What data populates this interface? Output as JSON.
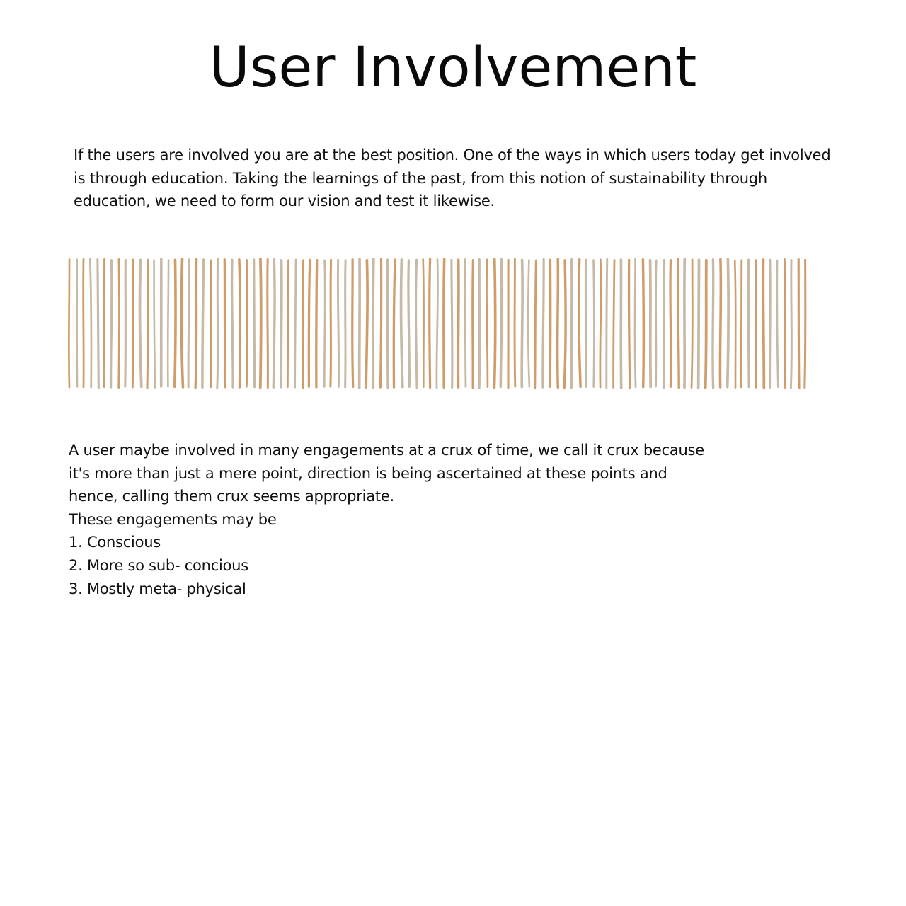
{
  "title": "User Involvement",
  "intro": "If the users are involved you are at the best position. One of the ways in which users today get involved is through education. Taking the learnings of the past, from this notion of sustainability through education, we need to form our vision and test it likewise.",
  "decoration": {
    "name": "vertical-stripes-pattern",
    "colors": {
      "tan": "#cf9d6b",
      "greige": "#c6b9a5"
    }
  },
  "body": {
    "lines": [
      "A user maybe involved in many engagements at a crux of time, we call it crux because",
      "it's more than just a mere point, direction is being ascertained at these points and",
      "hence, calling them crux seems appropriate.",
      "These engagements may be"
    ],
    "list": [
      "1. Conscious",
      "2. More so sub- concious",
      "3. Mostly meta- physical"
    ]
  }
}
